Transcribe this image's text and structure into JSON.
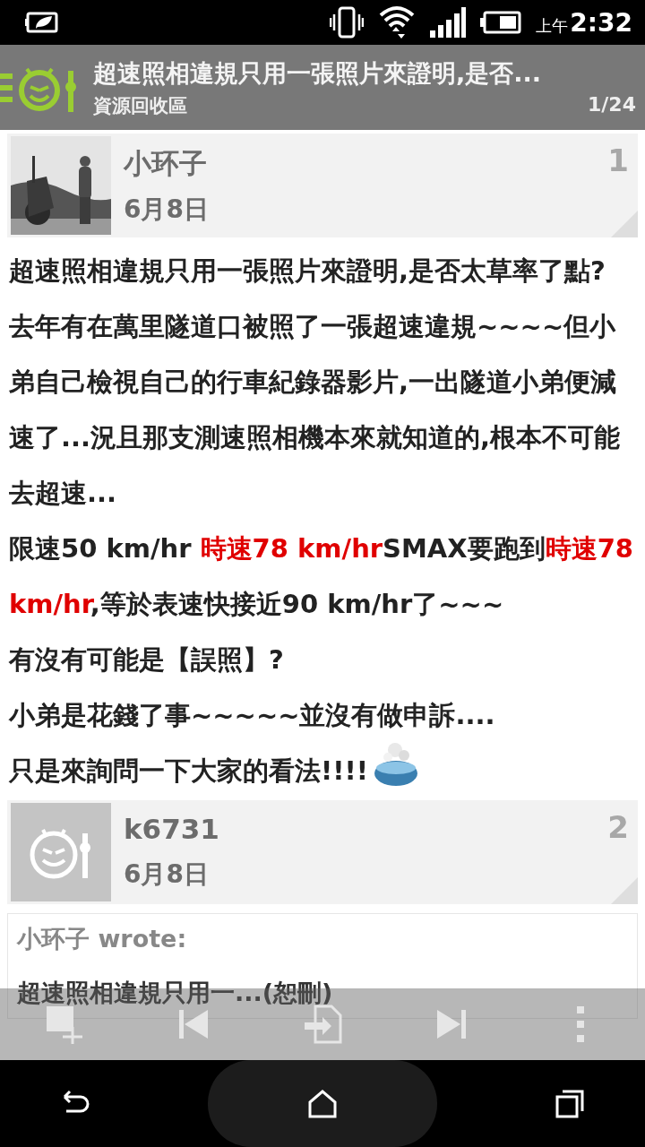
{
  "status_bar": {
    "time_prefix": "上午",
    "time": "2:32"
  },
  "header": {
    "title": "超速照相違規只用一張照片來證明,是否...",
    "forum": "資源回收區",
    "page": "1/24"
  },
  "posts": [
    {
      "author": "小环子",
      "date": "6月8日",
      "number": "1",
      "avatar": {
        "kind": "picture"
      },
      "paragraphs": [
        [
          {
            "kind": "text",
            "text": "超速照相違規只用一張照片來證明,是否太草率了點?",
            "emphasis": false
          }
        ],
        [
          {
            "kind": "text",
            "text": "去年有在萬里隧道口被照了一張超速違規~~~~但小弟自己檢視自己的行車紀錄器影片,一出隧道小弟便減速了...況且那支測速照相機本來就知道的,根本不可能去超速...",
            "emphasis": false
          }
        ],
        [
          {
            "kind": "text",
            "text": "限速50 km/hr ",
            "emphasis": false
          },
          {
            "kind": "text",
            "text": "時速78 km/hr",
            "emphasis": true
          },
          {
            "kind": "text",
            "text": "SMAX要跑到",
            "emphasis": false
          },
          {
            "kind": "text",
            "text": "時速78 km/hr",
            "emphasis": true
          },
          {
            "kind": "text",
            "text": ",等於表速快接近90 km/hr了~~~",
            "emphasis": false
          }
        ],
        [
          {
            "kind": "text",
            "text": "有沒有可能是【誤照】?",
            "emphasis": false
          }
        ],
        [
          {
            "kind": "text",
            "text": "小弟是花錢了事~~~~~並沒有做申訴....",
            "emphasis": false
          }
        ],
        [
          {
            "kind": "text",
            "text": "只是來詢問一下大家的看法!!!!",
            "emphasis": false
          },
          {
            "kind": "emoticon"
          }
        ]
      ]
    },
    {
      "author": "k6731",
      "date": "6月8日",
      "number": "2",
      "avatar": {
        "kind": "default"
      },
      "quote": {
        "author_line": "小环子 wrote:",
        "text": "超速照相違規只用一...(恕刪)"
      }
    }
  ]
}
